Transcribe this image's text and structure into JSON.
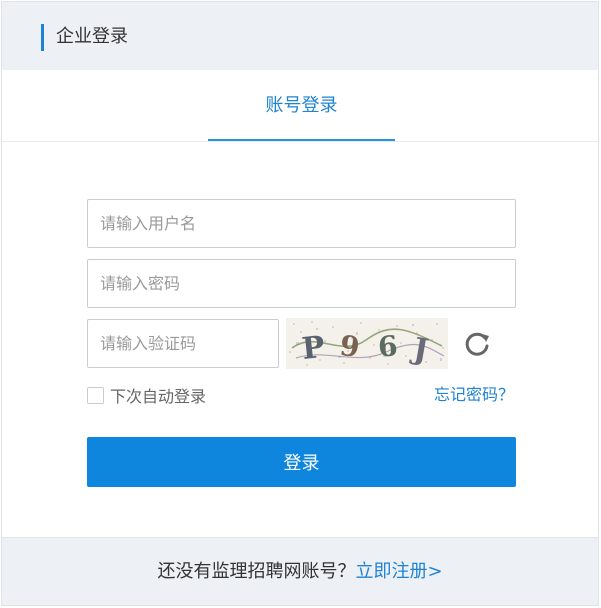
{
  "header": {
    "title": "企业登录"
  },
  "tabs": [
    {
      "label": "账号登录",
      "active": true
    }
  ],
  "form": {
    "username_placeholder": "请输入用户名",
    "password_placeholder": "请输入密码",
    "captcha_placeholder": "请输入验证码",
    "captcha_text": [
      "P",
      "9",
      "6",
      "J"
    ],
    "remember_label": "下次自动登录",
    "forgot_label": "忘记密码？",
    "submit_label": "登录"
  },
  "footer": {
    "prompt": "还没有监理招聘网账号？",
    "register_label": "立即注册>"
  },
  "colors": {
    "accent": "#1f83d3",
    "button": "#0f86de",
    "header_bg": "#edf0f4"
  }
}
